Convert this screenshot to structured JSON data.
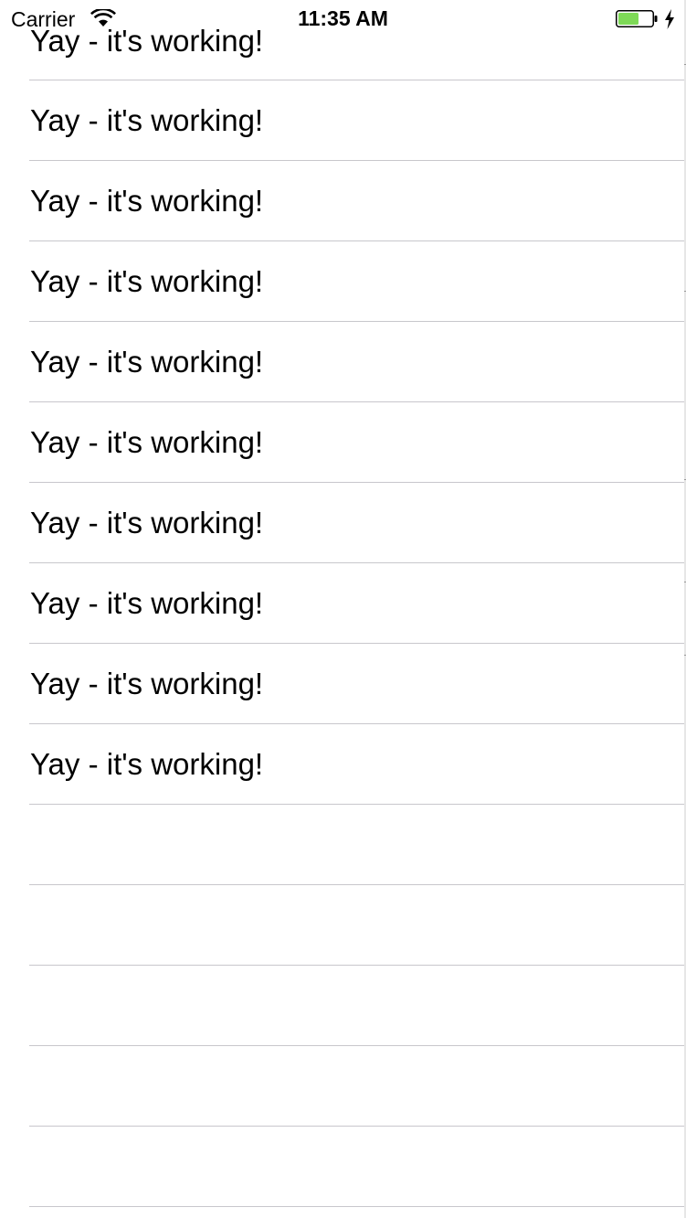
{
  "status_bar": {
    "carrier": "Carrier",
    "time": "11:35 AM",
    "battery_color": "#7ed957"
  },
  "table": {
    "rows": [
      {
        "text": "Yay - it's working!"
      },
      {
        "text": "Yay - it's working!"
      },
      {
        "text": "Yay - it's working!"
      },
      {
        "text": "Yay - it's working!"
      },
      {
        "text": "Yay - it's working!"
      },
      {
        "text": "Yay - it's working!"
      },
      {
        "text": "Yay - it's working!"
      },
      {
        "text": "Yay - it's working!"
      },
      {
        "text": "Yay - it's working!"
      },
      {
        "text": "Yay - it's working!"
      },
      {
        "text": ""
      },
      {
        "text": ""
      },
      {
        "text": ""
      },
      {
        "text": ""
      },
      {
        "text": ""
      }
    ],
    "separator_color": "#c8c7cc"
  }
}
